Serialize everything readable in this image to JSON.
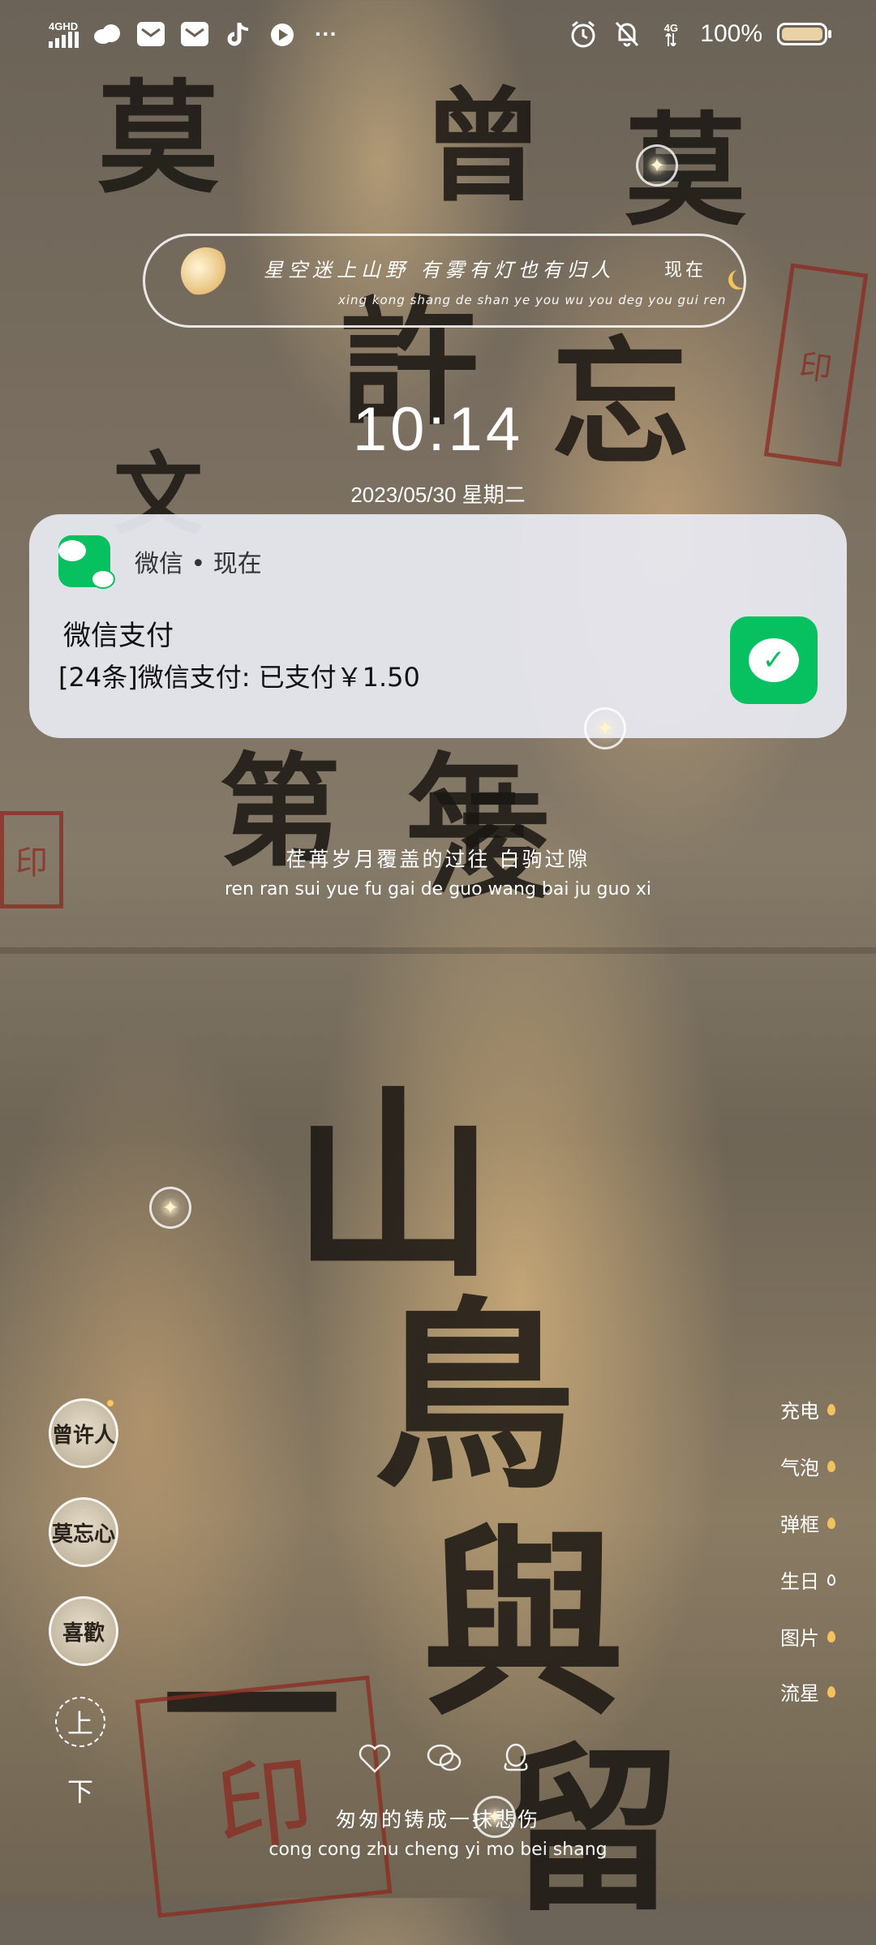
{
  "status_bar": {
    "signal_label": "4GHD",
    "network_label": "4G",
    "battery_percent_text": "100%",
    "battery_level": 1.0,
    "more_label": "···"
  },
  "lyric_pill": {
    "text": "星空迷上山野 有雾有灯也有归人",
    "pinyin": "xing kong shang de shan ye you wu you deg you gui ren",
    "now": "现在"
  },
  "clock": {
    "time": "10:14",
    "date": "2023/05/30 星期二"
  },
  "notification": {
    "app_name": "微信 • 现在",
    "title": "微信支付",
    "body": "[24条]微信支付: 已支付￥1.50",
    "accent": "#07c160"
  },
  "lyric_mid": {
    "text": "荏苒岁月覆盖的过往 白驹过隙",
    "pinyin": "ren ran sui yue fu gai de guo wang bai ju guo xi"
  },
  "left_controls": {
    "avatars": [
      "曾许人",
      "莫忘心",
      "喜歡"
    ],
    "up": "上",
    "down": "下"
  },
  "right_menu": [
    "充电",
    "气泡",
    "弹框",
    "生日",
    "图片",
    "流星"
  ],
  "bottom_icons": [
    "heart-icon",
    "wechat-icon",
    "qq-icon"
  ],
  "lyric_bottom": {
    "text": "匆匆的铸成一抹悲伤",
    "pinyin": "cong cong zhu cheng yi mo bei shang"
  }
}
